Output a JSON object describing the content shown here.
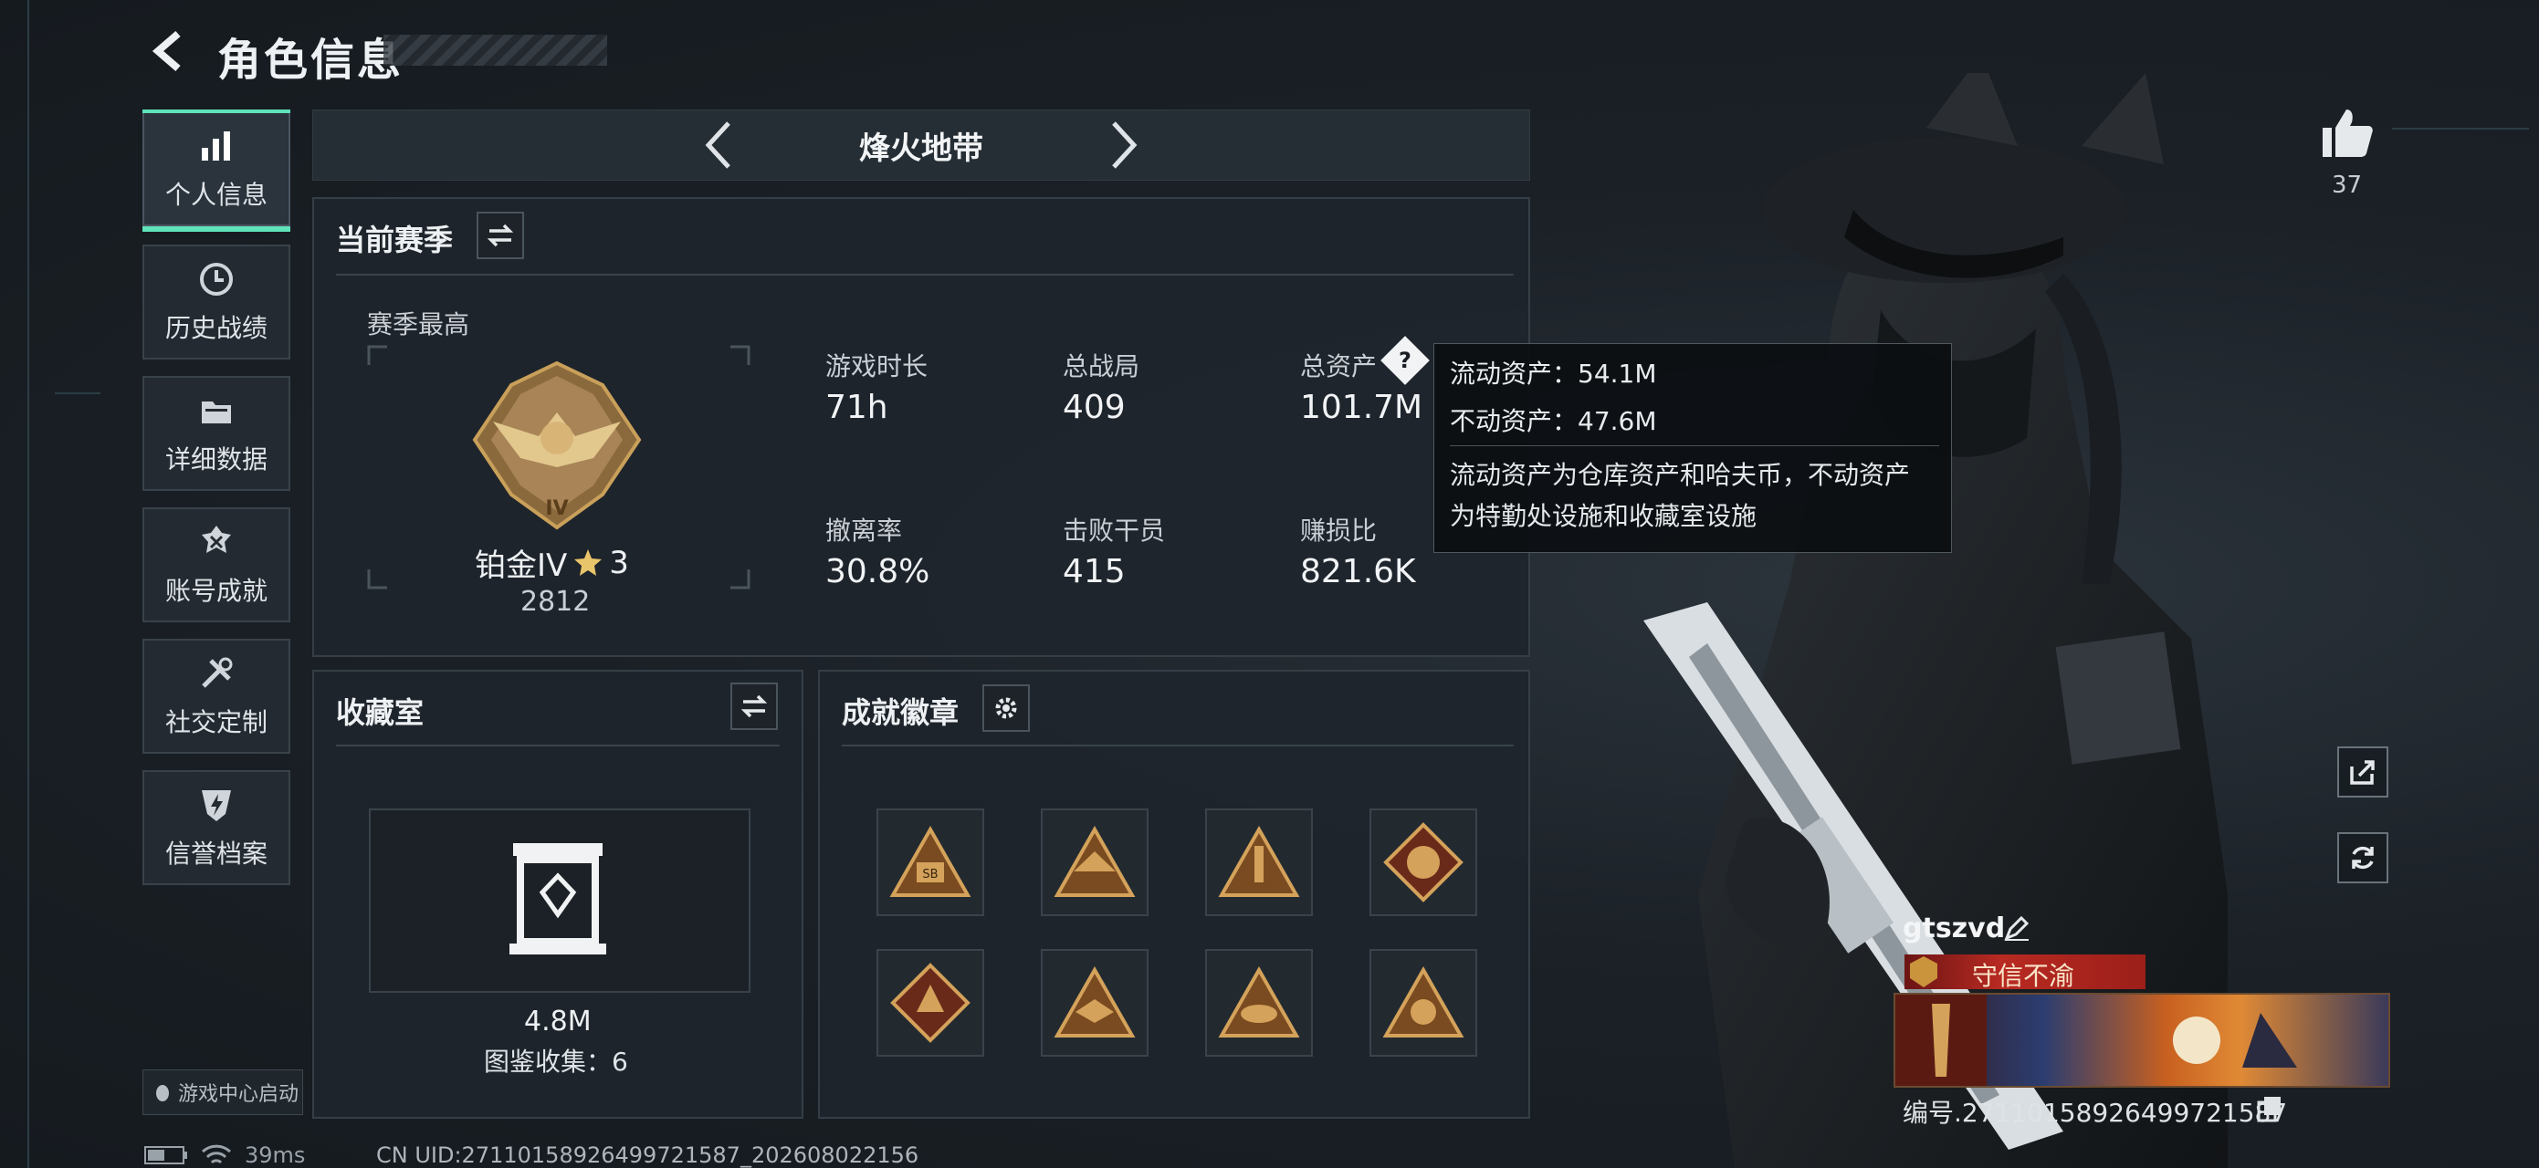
{
  "header": {
    "title": "角色信息"
  },
  "nav": {
    "items": [
      {
        "label": "个人信息",
        "icon": "bar-chart-icon"
      },
      {
        "label": "历史战绩",
        "icon": "clock-icon"
      },
      {
        "label": "详细数据",
        "icon": "folder-icon"
      },
      {
        "label": "账号成就",
        "icon": "medal-icon"
      },
      {
        "label": "社交定制",
        "icon": "tools-icon"
      },
      {
        "label": "信誉档案",
        "icon": "shield-icon"
      }
    ],
    "active_index": 0,
    "game_center_label": "游戏中心启动"
  },
  "mode": {
    "title": "烽火地带"
  },
  "season": {
    "title": "当前赛季",
    "best_label": "赛季最高",
    "rank_name": "铂金IV",
    "rank_stars": "3",
    "rank_score": "2812",
    "rank_emblem_text": "IV",
    "stats": [
      {
        "label": "游戏时长",
        "value": "71h"
      },
      {
        "label": "总战局",
        "value": "409"
      },
      {
        "label": "总资产",
        "value": "101.7M"
      },
      {
        "label": "撤离率",
        "value": "30.8%"
      },
      {
        "label": "击败干员",
        "value": "415"
      },
      {
        "label": "赚损比",
        "value": "821.6K"
      }
    ]
  },
  "tooltip": {
    "liquid": "流动资产：54.1M",
    "fixed": "不动资产：47.6M",
    "description": "流动资产为仓库资产和哈夫币，不动资产为特勤处设施和收藏室设施"
  },
  "collection": {
    "title": "收藏室",
    "value": "4.8M",
    "catalog": "图鉴收集：6"
  },
  "achievements": {
    "title": "成就徽章",
    "badges": [
      "badge-sb-icon",
      "badge-helmet-icon",
      "badge-rocket-icon",
      "badge-wolf-icon",
      "badge-dragon-icon",
      "badge-eagle-icon",
      "badge-hat-icon",
      "badge-bear-icon"
    ]
  },
  "social": {
    "likes": "37"
  },
  "player": {
    "name": "gtszvd",
    "tag": "守信不渝",
    "uid_card": "编号.27110158926499721587"
  },
  "status": {
    "ping": "39ms",
    "uid": "CN UID:27110158926499721587_202608022156"
  },
  "colors": {
    "accent": "#5fe3b8",
    "tag_red": "#b82a22",
    "gold": "#c9a05a"
  }
}
